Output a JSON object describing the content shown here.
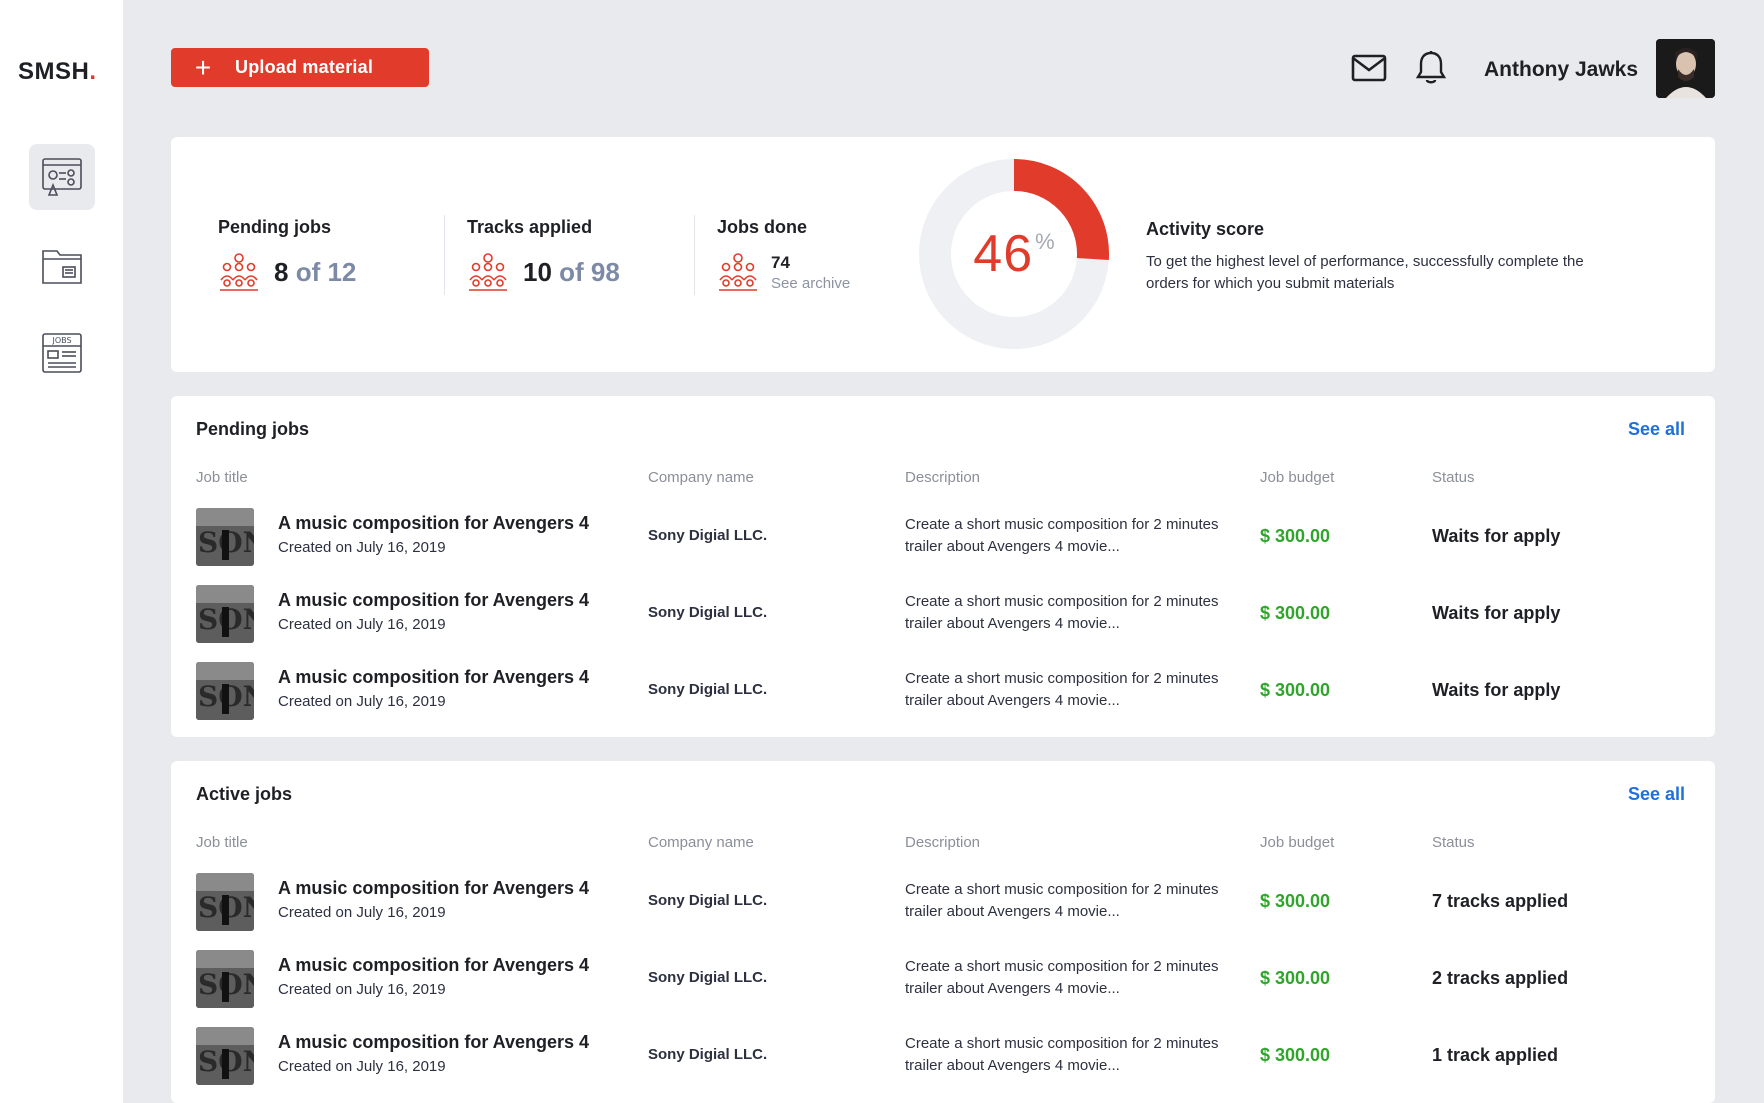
{
  "brand": {
    "name": "SMSH",
    "dot": ".",
    "accent": "#e13b2b"
  },
  "sidebar": {
    "items": [
      {
        "icon": "dashboard-icon",
        "active": true
      },
      {
        "icon": "folder-icon",
        "active": false
      },
      {
        "icon": "jobs-board-icon",
        "label": "JOBS",
        "active": false
      }
    ]
  },
  "header": {
    "upload_label": "Upload material",
    "upload_plus": "+",
    "user_name": "Anthony Jawks"
  },
  "stats": {
    "pending": {
      "title": "Pending jobs",
      "value": "8",
      "of": "of 12"
    },
    "tracks": {
      "title": "Tracks applied",
      "value": "10",
      "of": "of 98"
    },
    "done": {
      "title": "Jobs done",
      "value": "74",
      "link": "See archive"
    },
    "activity": {
      "score": "46",
      "percent_sign": "%",
      "score_fraction": 0.26,
      "title": "Activity score",
      "description": "To get the highest level of performance, successfully complete the orders for which you submit materials"
    }
  },
  "columns": {
    "job_title": "Job title",
    "company": "Company name",
    "description": "Description",
    "budget": "Job budget",
    "status": "Status"
  },
  "pending_jobs": {
    "title": "Pending jobs",
    "see_all": "See all",
    "rows": [
      {
        "title": "A music composition for Avengers 4",
        "created": "Created on July 16, 2019",
        "company": "Sony Digial LLC.",
        "description": "Create a short music composition for 2 minutes trailer about Avengers 4 movie...",
        "budget": "$ 300.00",
        "status": "Waits for apply"
      },
      {
        "title": "A music composition for Avengers 4",
        "created": "Created on July 16, 2019",
        "company": "Sony Digial LLC.",
        "description": "Create a short music composition for 2 minutes trailer about Avengers 4 movie...",
        "budget": "$ 300.00",
        "status": "Waits for apply"
      },
      {
        "title": "A music composition for Avengers 4",
        "created": "Created on July 16, 2019",
        "company": "Sony Digial LLC.",
        "description": "Create a short music composition for 2 minutes trailer about Avengers 4 movie...",
        "budget": "$ 300.00",
        "status": "Waits for apply"
      }
    ]
  },
  "active_jobs": {
    "title": "Active jobs",
    "see_all": "See all",
    "rows": [
      {
        "title": "A music composition for Avengers 4",
        "created": "Created on July 16, 2019",
        "company": "Sony Digial LLC.",
        "description": "Create a short music composition for 2 minutes trailer about Avengers 4 movie...",
        "budget": "$ 300.00",
        "status": "7 tracks applied"
      },
      {
        "title": "A music composition for Avengers 4",
        "created": "Created on July 16, 2019",
        "company": "Sony Digial LLC.",
        "description": "Create a short music composition for 2 minutes trailer about Avengers 4 movie...",
        "budget": "$ 300.00",
        "status": "2 tracks applied"
      },
      {
        "title": "A music composition for Avengers 4",
        "created": "Created on July 16, 2019",
        "company": "Sony Digial LLC.",
        "description": "Create a short music composition for 2 minutes trailer about Avengers 4 movie...",
        "budget": "$ 300.00",
        "status": "1 track applied"
      }
    ]
  },
  "colors": {
    "accent": "#e13b2b",
    "link": "#1f6fdc",
    "budget": "#2fa62b",
    "background": "#e9eaee"
  }
}
